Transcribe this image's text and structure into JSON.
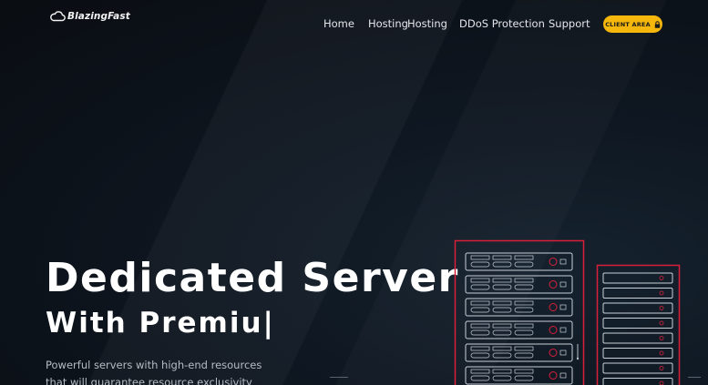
{
  "brand": {
    "name": "BlazingFast"
  },
  "nav": {
    "items": [
      {
        "label": "Home"
      },
      {
        "label": "Hosting"
      },
      {
        "label": "Hosting"
      },
      {
        "label": "DDoS Protection"
      },
      {
        "label": "Support"
      }
    ],
    "client_area": {
      "label": "CLIENT AREA",
      "icon": "lock-icon"
    }
  },
  "hero": {
    "title": "Dedicated Server",
    "subtitle": "With Premiu|",
    "description": "Powerful servers with high-end resources that will guarantee resource exclusivity"
  },
  "colors": {
    "accent": "#f5b70c",
    "server_outline": "#d8203a",
    "background": "#0b0f14"
  }
}
